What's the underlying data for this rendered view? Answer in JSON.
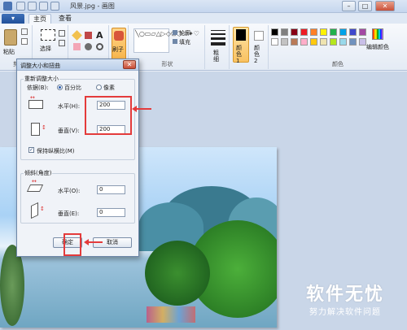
{
  "window": {
    "title": "风景.jpg - 画图",
    "minimize": "–",
    "maximize": "□",
    "close": "✕"
  },
  "tabs": {
    "file": "▾",
    "home": "主页",
    "view": "查看"
  },
  "ribbon": {
    "paste": "粘贴",
    "select": "选择",
    "brushes": "刷子",
    "fill": "填充",
    "outline": "轮廓",
    "shapes_group": "形状",
    "size": "粗细",
    "color1": "颜色 1",
    "color2": "颜色 2",
    "edit_colors": "编辑颜色",
    "colors_group": "颜色",
    "image_group": "图",
    "clipboard_group": "剪"
  },
  "palette": [
    "#000000",
    "#7f7f7f",
    "#880015",
    "#ed1c24",
    "#ff7f27",
    "#fff200",
    "#22b14c",
    "#00a2e8",
    "#3f48cc",
    "#a349a4",
    "#ffffff",
    "#c3c3c3",
    "#b97a57",
    "#ffaec9",
    "#ffc90e",
    "#efe4b0",
    "#b5e61d",
    "#99d9ea",
    "#7092be",
    "#c8bfe7"
  ],
  "dialog": {
    "title": "调整大小和扭曲",
    "close": "✕",
    "resize_legend": "重新调整大小",
    "by_label": "依据(B):",
    "percent": "百分比",
    "pixels": "像素",
    "horizontal_label": "水平(H):",
    "horizontal_value": "200",
    "vertical_label": "垂直(V):",
    "vertical_value": "200",
    "keep_ratio": "保持纵横比(M)",
    "skew_legend": "倾斜(角度)",
    "skew_h_label": "水平(O):",
    "skew_h_value": "0",
    "skew_v_label": "垂直(E):",
    "skew_v_value": "0",
    "ok": "确定",
    "cancel": "取消"
  },
  "watermark": {
    "title": "软件无忧",
    "subtitle": "努力解决软件问题"
  }
}
